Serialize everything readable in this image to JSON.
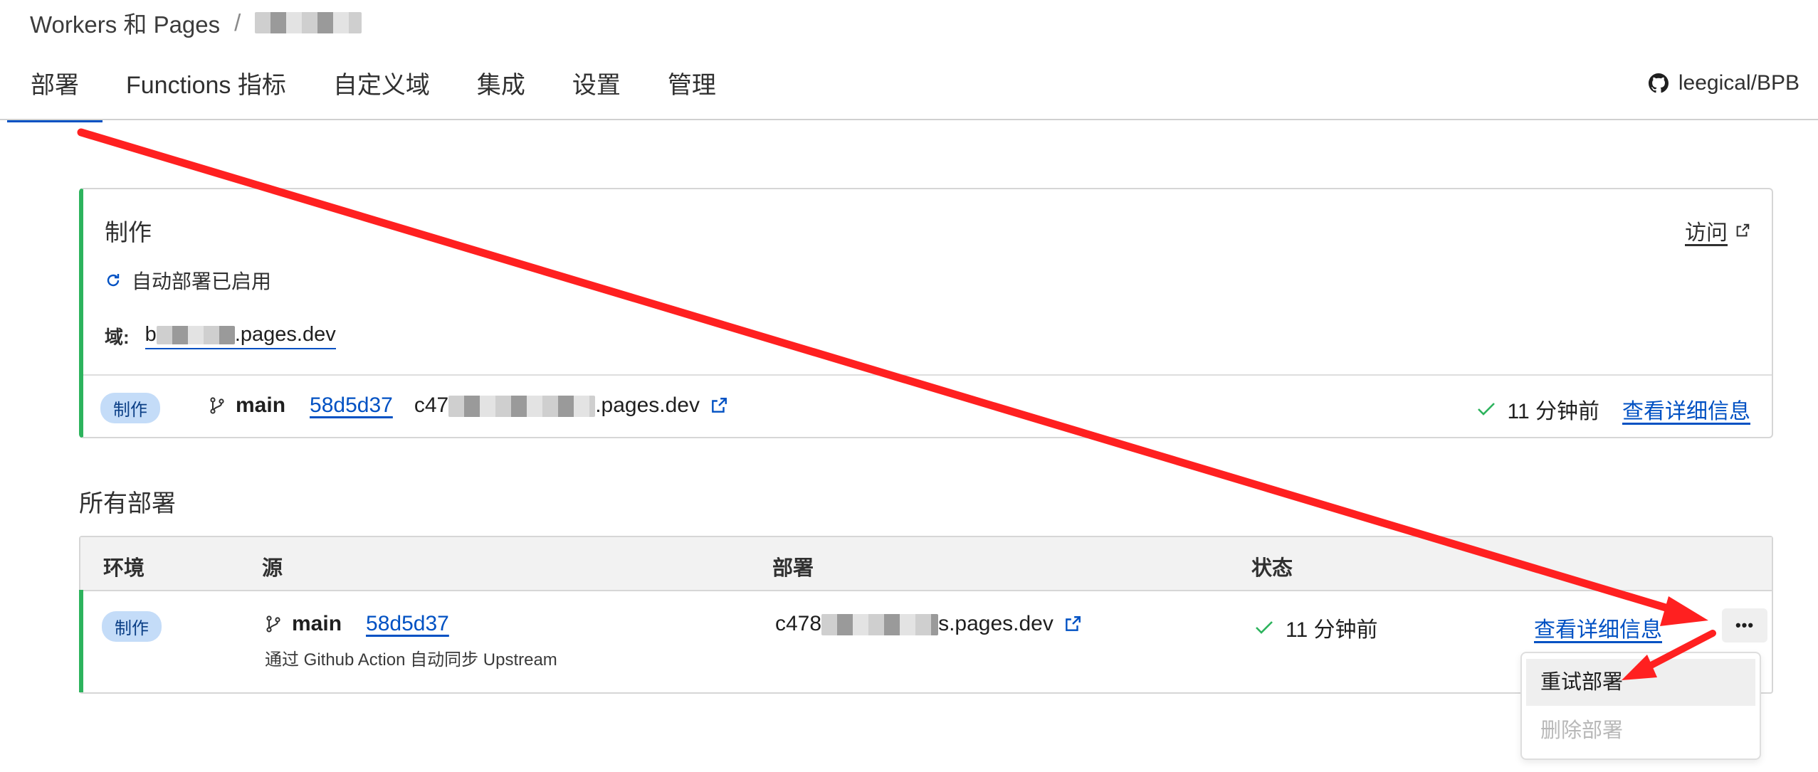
{
  "breadcrumb": {
    "root": "Workers 和 Pages",
    "separator": "/"
  },
  "tabs": [
    {
      "label": "部署",
      "active": true
    },
    {
      "label": "Functions 指标"
    },
    {
      "label": "自定义域"
    },
    {
      "label": "集成"
    },
    {
      "label": "设置"
    },
    {
      "label": "管理"
    }
  ],
  "repo": {
    "name": "leegical/BPB"
  },
  "production": {
    "title": "制作",
    "visit_label": "访问",
    "auto_deploy": "自动部署已启用",
    "domain_label": "域:",
    "domain_prefix": "b",
    "domain_suffix": ".pages.dev",
    "latest": {
      "env_badge": "制作",
      "branch": "main",
      "commit": "58d5d37",
      "url_prefix": "c47",
      "url_suffix": ".pages.dev",
      "time": "11 分钟前",
      "details": "查看详细信息"
    }
  },
  "all_deployments": {
    "title": "所有部署",
    "headers": {
      "env": "环境",
      "source": "源",
      "deployment": "部署",
      "status": "状态"
    },
    "rows": [
      {
        "env_badge": "制作",
        "branch": "main",
        "commit": "58d5d37",
        "message": "通过 Github Action 自动同步 Upstream",
        "url_prefix": "c478",
        "url_suffix": "s.pages.dev",
        "time": "11 分钟前",
        "details": "查看详细信息",
        "more": "•••"
      }
    ]
  },
  "row_menu": {
    "retry": "重试部署",
    "delete": "删除部署"
  },
  "colors": {
    "accent": "#0051c3",
    "success": "#2db35d",
    "annotation": "#ff2020",
    "badge_bg": "#c4dcf8"
  },
  "icons": [
    "github-icon",
    "refresh-icon",
    "external-link-icon",
    "branch-icon",
    "check-icon",
    "more-icon"
  ]
}
